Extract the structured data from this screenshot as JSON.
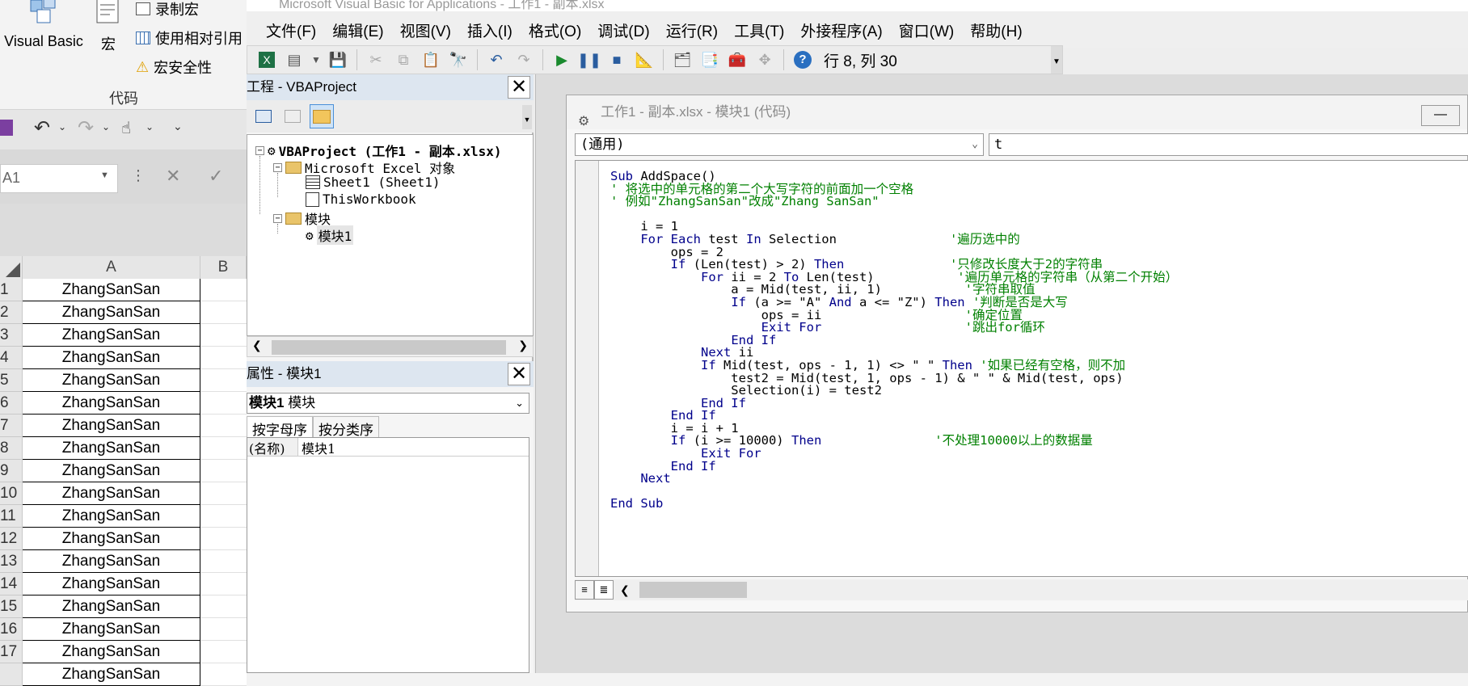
{
  "excel": {
    "ribbon": {
      "visual_basic_label": "Visual Basic",
      "macros_label": "宏",
      "record_macro_label": "录制宏",
      "relative_ref_label": "使用相对引用",
      "macro_security_label": "宏安全性",
      "group_label": "代码"
    },
    "name_box": "A1",
    "column_headers": [
      "A",
      "B"
    ],
    "rows": [
      {
        "n": "1",
        "a": "ZhangSanSan"
      },
      {
        "n": "2",
        "a": "ZhangSanSan"
      },
      {
        "n": "3",
        "a": "ZhangSanSan"
      },
      {
        "n": "4",
        "a": "ZhangSanSan"
      },
      {
        "n": "5",
        "a": "ZhangSanSan"
      },
      {
        "n": "6",
        "a": "ZhangSanSan"
      },
      {
        "n": "7",
        "a": "ZhangSanSan"
      },
      {
        "n": "8",
        "a": "ZhangSanSan"
      },
      {
        "n": "9",
        "a": "ZhangSanSan"
      },
      {
        "n": "10",
        "a": "ZhangSanSan"
      },
      {
        "n": "11",
        "a": "ZhangSanSan"
      },
      {
        "n": "12",
        "a": "ZhangSanSan"
      },
      {
        "n": "13",
        "a": "ZhangSanSan"
      },
      {
        "n": "14",
        "a": "ZhangSanSan"
      },
      {
        "n": "15",
        "a": "ZhangSanSan"
      },
      {
        "n": "16",
        "a": "ZhangSanSan"
      },
      {
        "n": "17",
        "a": "ZhangSanSan"
      },
      {
        "n": "",
        "a": "ZhangSanSan"
      }
    ]
  },
  "vbe": {
    "window_title": "Microsoft Visual Basic for Applications - 工作1 - 副本.xlsx",
    "menu": [
      "文件(F)",
      "编辑(E)",
      "视图(V)",
      "插入(I)",
      "格式(O)",
      "调试(D)",
      "运行(R)",
      "工具(T)",
      "外接程序(A)",
      "窗口(W)",
      "帮助(H)"
    ],
    "toolbar_position": "行 8, 列 30",
    "project_pane": {
      "title": "工程 - VBAProject",
      "tree": {
        "root": "VBAProject (工作1 - 副本.xlsx)",
        "excel_objects": "Microsoft Excel 对象",
        "sheet1": "Sheet1 (Sheet1)",
        "this_workbook": "ThisWorkbook",
        "modules": "模块",
        "module1": "模块1"
      }
    },
    "properties_pane": {
      "title": "属性 - 模块1",
      "object_bold": "模块1",
      "object_type": "模块",
      "tab_alpha": "按字母序",
      "tab_category": "按分类序",
      "prop_name_key": "(名称)",
      "prop_name_value": "模块1"
    },
    "code_window": {
      "title": "工作1 - 副本.xlsx - 模块1 (代码)",
      "object_combo": "(通用)",
      "proc_combo": "t",
      "lines": [
        [
          [
            "kw",
            "Sub"
          ],
          [
            "t",
            " AddSpace()"
          ]
        ],
        [
          [
            "cm",
            "' 将选中的单元格的第二个大写字符的前面加一个空格"
          ]
        ],
        [
          [
            "cm",
            "' 例如\"ZhangSanSan\"改成\"Zhang SanSan\""
          ]
        ],
        [
          [
            "t",
            ""
          ]
        ],
        [
          [
            "t",
            "    i = 1"
          ]
        ],
        [
          [
            "t",
            "    "
          ],
          [
            "kw",
            "For Each"
          ],
          [
            "t",
            " test "
          ],
          [
            "kw",
            "In"
          ],
          [
            "t",
            " Selection               "
          ],
          [
            "cm",
            "'遍历选中的"
          ]
        ],
        [
          [
            "t",
            "        ops = 2"
          ]
        ],
        [
          [
            "t",
            "        "
          ],
          [
            "kw",
            "If"
          ],
          [
            "t",
            " (Len(test) > 2) "
          ],
          [
            "kw",
            "Then"
          ],
          [
            "t",
            "              "
          ],
          [
            "cm",
            "'只修改长度大于2的字符串"
          ]
        ],
        [
          [
            "t",
            "            "
          ],
          [
            "kw",
            "For"
          ],
          [
            "t",
            " ii = 2 "
          ],
          [
            "kw",
            "To"
          ],
          [
            "t",
            " Len(test)           "
          ],
          [
            "cm",
            "'遍历单元格的字符串（从第二个开始）"
          ]
        ],
        [
          [
            "t",
            "                a = Mid(test, ii, 1)           "
          ],
          [
            "cm",
            "'字符串取值"
          ]
        ],
        [
          [
            "t",
            "                "
          ],
          [
            "kw",
            "If"
          ],
          [
            "t",
            " (a >= \"A\" "
          ],
          [
            "kw",
            "And"
          ],
          [
            "t",
            " a <= \"Z\") "
          ],
          [
            "kw",
            "Then"
          ],
          [
            "t",
            " "
          ],
          [
            "cm",
            "'判断是否是大写"
          ]
        ],
        [
          [
            "t",
            "                    ops = ii                   "
          ],
          [
            "cm",
            "'确定位置"
          ]
        ],
        [
          [
            "t",
            "                    "
          ],
          [
            "kw",
            "Exit For"
          ],
          [
            "t",
            "                   "
          ],
          [
            "cm",
            "'跳出for循环"
          ]
        ],
        [
          [
            "t",
            "                "
          ],
          [
            "kw",
            "End If"
          ]
        ],
        [
          [
            "t",
            "            "
          ],
          [
            "kw",
            "Next"
          ],
          [
            "t",
            " ii"
          ]
        ],
        [
          [
            "t",
            "            "
          ],
          [
            "kw",
            "If"
          ],
          [
            "t",
            " Mid(test, ops - 1, 1) <> \" \" "
          ],
          [
            "kw",
            "Then"
          ],
          [
            "t",
            " "
          ],
          [
            "cm",
            "'如果已经有空格，则不加"
          ]
        ],
        [
          [
            "t",
            "                test2 = Mid(test, 1, ops - 1) & \" \" & Mid(test, ops)"
          ]
        ],
        [
          [
            "t",
            "                Selection(i) = test2"
          ]
        ],
        [
          [
            "t",
            "            "
          ],
          [
            "kw",
            "End If"
          ]
        ],
        [
          [
            "t",
            "        "
          ],
          [
            "kw",
            "End If"
          ]
        ],
        [
          [
            "t",
            "        i = i + 1"
          ]
        ],
        [
          [
            "t",
            "        "
          ],
          [
            "kw",
            "If"
          ],
          [
            "t",
            " (i >= 10000) "
          ],
          [
            "kw",
            "Then"
          ],
          [
            "t",
            "               "
          ],
          [
            "cm",
            "'不处理10000以上的数据量"
          ]
        ],
        [
          [
            "t",
            "            "
          ],
          [
            "kw",
            "Exit For"
          ]
        ],
        [
          [
            "t",
            "        "
          ],
          [
            "kw",
            "End If"
          ]
        ],
        [
          [
            "t",
            "    "
          ],
          [
            "kw",
            "Next"
          ]
        ],
        [
          [
            "t",
            ""
          ]
        ],
        [
          [
            "kw",
            "End Sub"
          ]
        ]
      ]
    }
  },
  "colors": {
    "keyword": "#00008b",
    "comment": "#008000",
    "pane_header": "#dde6f0"
  }
}
